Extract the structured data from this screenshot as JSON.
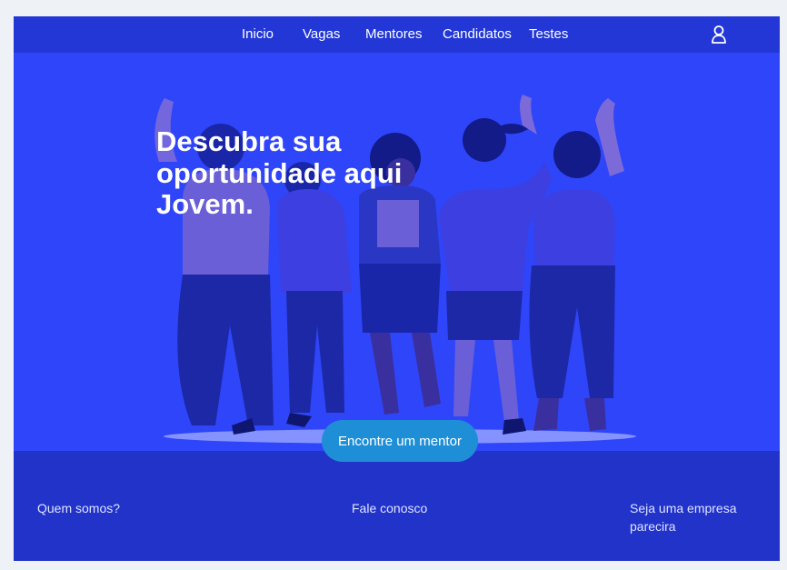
{
  "nav": {
    "items": [
      {
        "label": "Inicio"
      },
      {
        "label": "Vagas"
      },
      {
        "label": "Mentores"
      },
      {
        "label": "Candidatos"
      },
      {
        "label": "Testes"
      }
    ],
    "user_icon": "user-icon"
  },
  "hero": {
    "title": "Descubra sua oportunidade aqui Jovem.",
    "cta_label": "Encontre um mentor",
    "illustration": "group-of-young-people-illustration"
  },
  "footer": {
    "links": [
      {
        "label": "Quem somos?"
      },
      {
        "label": "Fale conosco"
      },
      {
        "label": "Seja uma empresa parecira"
      }
    ]
  },
  "colors": {
    "page_background": "#eef1f6",
    "nav_background": "#2237d6",
    "hero_background": "#2f45fa",
    "footer_background": "#2133c9",
    "cta_background": "#1e8fd6",
    "text_white": "#ffffff"
  }
}
